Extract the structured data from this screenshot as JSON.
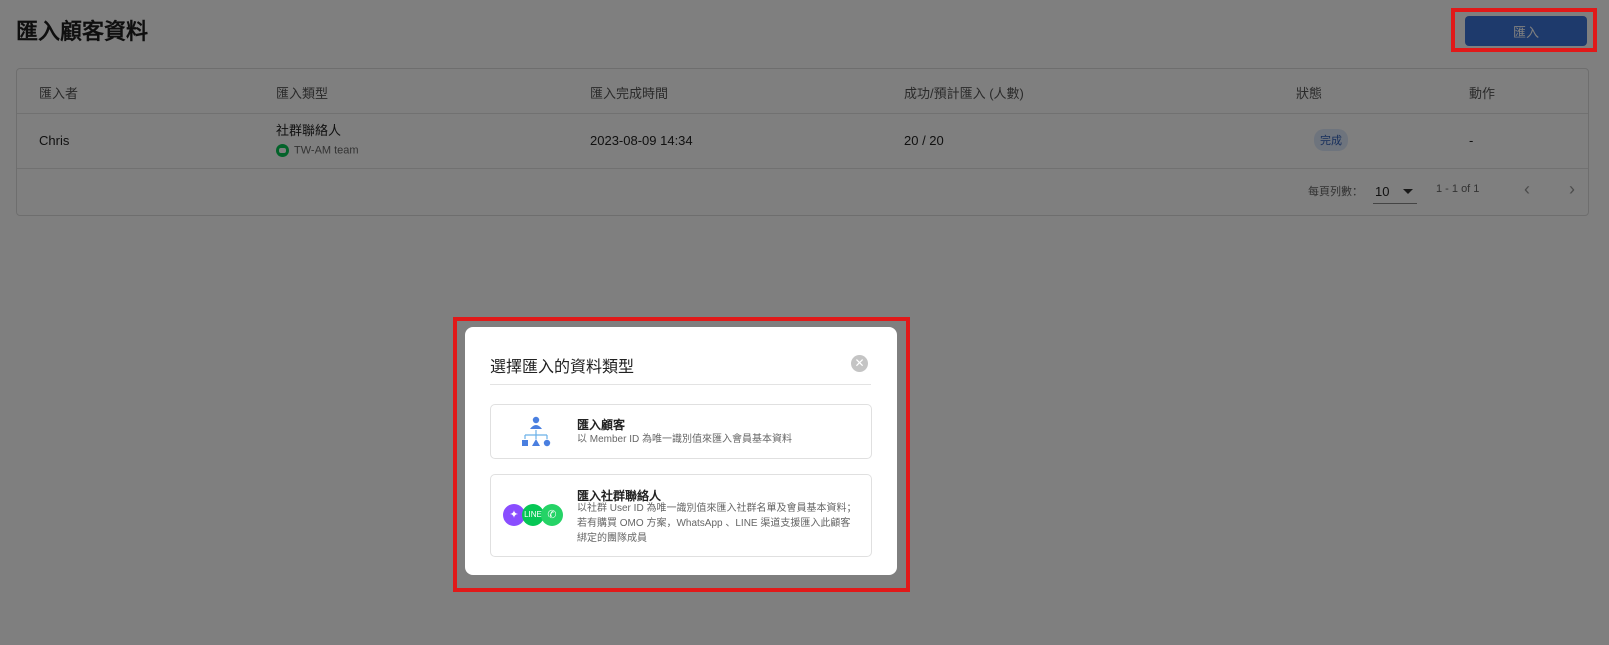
{
  "page": {
    "title": "匯入顧客資料",
    "import_button": "匯入"
  },
  "table": {
    "headers": [
      "匯入者",
      "匯入類型",
      "匯入完成時間",
      "成功/預計匯入 (人數)",
      "狀態",
      "動作"
    ],
    "rows": [
      {
        "importer": "Chris",
        "type": "社群聯絡人",
        "channel": "TW-AM team",
        "completed_at": "2023-08-09 14:34",
        "success_expected": "20 / 20",
        "status": "完成",
        "action": "-"
      }
    ],
    "pagination": {
      "rows_per_page_label": "每頁列數：",
      "rows_per_page": "10",
      "range": "1 - 1 of 1"
    }
  },
  "modal": {
    "title": "選擇匯入的資料類型",
    "options": [
      {
        "title": "匯入顧客",
        "description": "以 Member ID 為唯一識別值來匯入會員基本資料",
        "icon": "org-chart-icon"
      },
      {
        "title": "匯入社群聯絡人",
        "description": "以社群 User ID 為唯一識別值來匯入社群名單及會員基本資料；若有購買 OMO 方案，WhatsApp 、LINE 渠道支援匯入此顧客綁定的團隊成員",
        "icon": "social-channels-icon"
      }
    ]
  },
  "colors": {
    "primary": "#3d74d9",
    "highlight": "#e11919",
    "line": "#06c755",
    "messenger": "#a044ff",
    "whatsapp": "#25d366"
  }
}
